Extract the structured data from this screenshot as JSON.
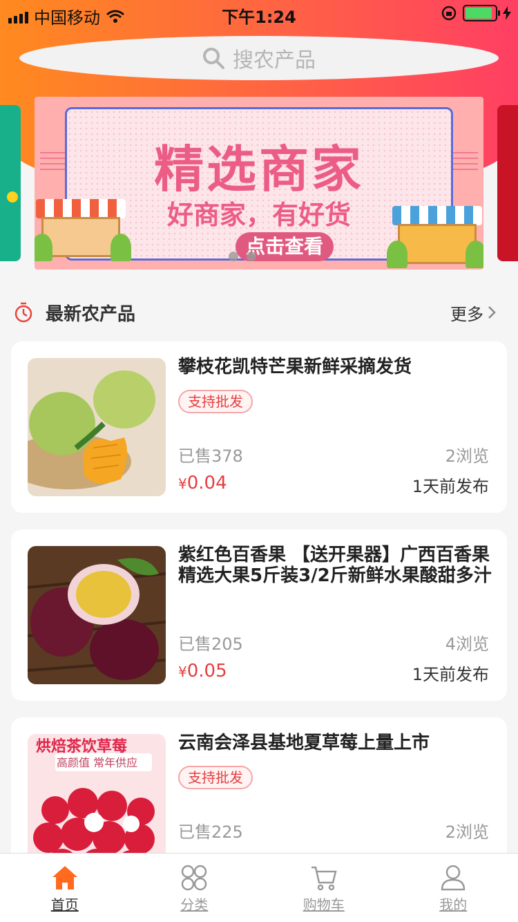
{
  "status_bar": {
    "carrier": "中国移动",
    "time": "下午1:24",
    "battery_level": 0.9
  },
  "search": {
    "placeholder": "搜农产品",
    "icon": "search-icon"
  },
  "banner": {
    "title": "精选商家",
    "subtitle": "好商家，有好货",
    "cta": "点击查看",
    "slide_count": 2,
    "active_slide": 1
  },
  "section": {
    "title": "最新农产品",
    "more_label": "更多",
    "icon": "clock-icon"
  },
  "products": [
    {
      "name": "攀枝花凯特芒果新鲜采摘发货",
      "tag": "支持批发",
      "sold": "已售378",
      "views": "2浏览",
      "currency": "¥",
      "price": "0.04",
      "posted": "1天前发布",
      "image": "mango-photo"
    },
    {
      "name": "紫红色百香果 【送开果器】广西百香果精选大果5斤装3/2斤新鲜水果酸甜多汁",
      "tag": "",
      "sold": "已售205",
      "views": "4浏览",
      "currency": "¥",
      "price": "0.05",
      "posted": "1天前发布",
      "image": "passion-fruit-photo"
    },
    {
      "name": "云南会泽县基地夏草莓上量上市",
      "tag": "支持批发",
      "sold": "已售225",
      "views": "2浏览",
      "currency": "¥",
      "price": "",
      "posted": "",
      "image": "strawberry-photo",
      "image_text": {
        "headline": "烘焙茶饮草莓",
        "caption": "高颜值 常年供应"
      }
    }
  ],
  "tabbar": [
    {
      "label": "首页",
      "icon": "home-icon",
      "active": true
    },
    {
      "label": "分类",
      "icon": "category-icon",
      "active": false
    },
    {
      "label": "购物车",
      "icon": "cart-icon",
      "active": false
    },
    {
      "label": "我的",
      "icon": "profile-icon",
      "active": false
    }
  ],
  "colors": {
    "accent": "#ff6a3d",
    "price": "#e53e3e",
    "tab_active": "#ff6a1f"
  }
}
